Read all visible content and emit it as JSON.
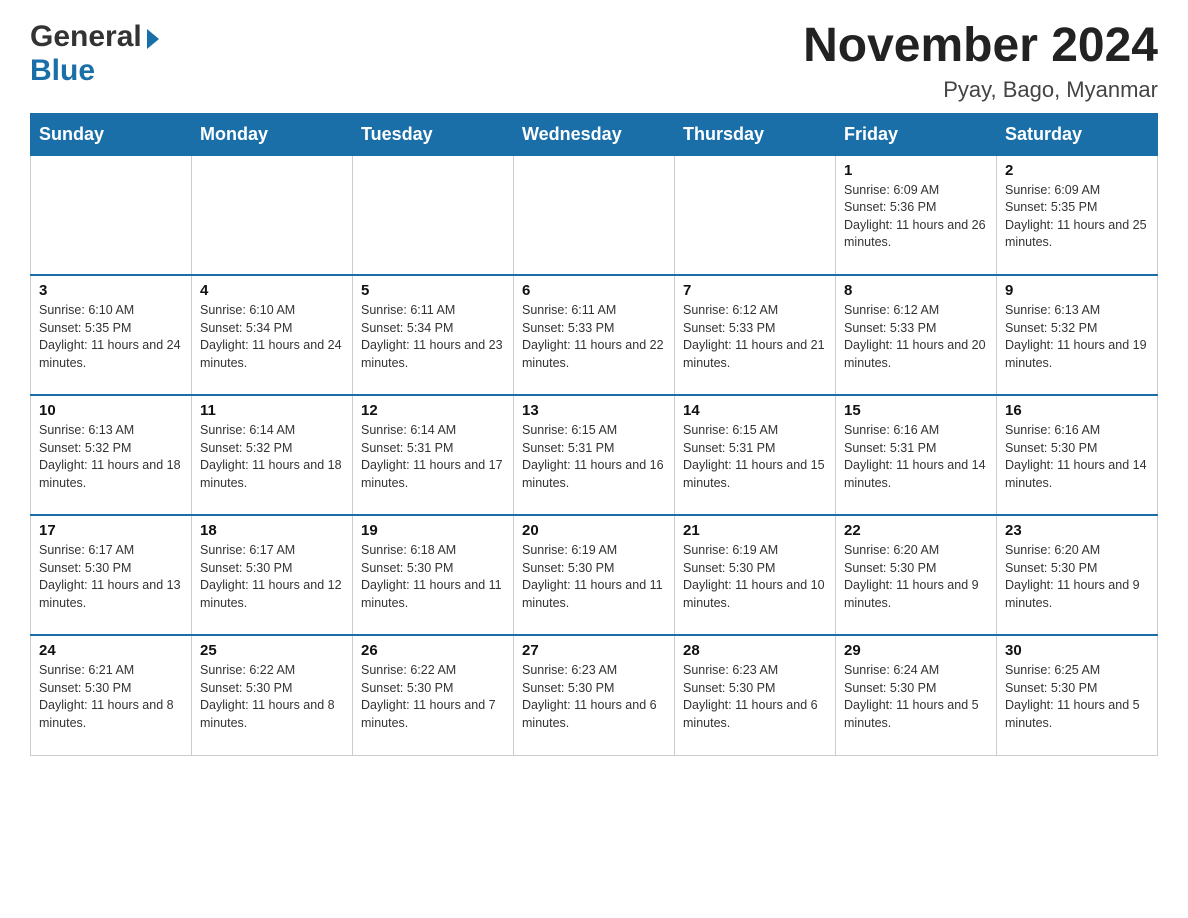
{
  "header": {
    "logo_general": "General",
    "logo_blue": "Blue",
    "title": "November 2024",
    "subtitle": "Pyay, Bago, Myanmar"
  },
  "days_of_week": [
    "Sunday",
    "Monday",
    "Tuesday",
    "Wednesday",
    "Thursday",
    "Friday",
    "Saturday"
  ],
  "weeks": [
    {
      "days": [
        {
          "number": "",
          "info": ""
        },
        {
          "number": "",
          "info": ""
        },
        {
          "number": "",
          "info": ""
        },
        {
          "number": "",
          "info": ""
        },
        {
          "number": "",
          "info": ""
        },
        {
          "number": "1",
          "info": "Sunrise: 6:09 AM\nSunset: 5:36 PM\nDaylight: 11 hours and 26 minutes."
        },
        {
          "number": "2",
          "info": "Sunrise: 6:09 AM\nSunset: 5:35 PM\nDaylight: 11 hours and 25 minutes."
        }
      ]
    },
    {
      "days": [
        {
          "number": "3",
          "info": "Sunrise: 6:10 AM\nSunset: 5:35 PM\nDaylight: 11 hours and 24 minutes."
        },
        {
          "number": "4",
          "info": "Sunrise: 6:10 AM\nSunset: 5:34 PM\nDaylight: 11 hours and 24 minutes."
        },
        {
          "number": "5",
          "info": "Sunrise: 6:11 AM\nSunset: 5:34 PM\nDaylight: 11 hours and 23 minutes."
        },
        {
          "number": "6",
          "info": "Sunrise: 6:11 AM\nSunset: 5:33 PM\nDaylight: 11 hours and 22 minutes."
        },
        {
          "number": "7",
          "info": "Sunrise: 6:12 AM\nSunset: 5:33 PM\nDaylight: 11 hours and 21 minutes."
        },
        {
          "number": "8",
          "info": "Sunrise: 6:12 AM\nSunset: 5:33 PM\nDaylight: 11 hours and 20 minutes."
        },
        {
          "number": "9",
          "info": "Sunrise: 6:13 AM\nSunset: 5:32 PM\nDaylight: 11 hours and 19 minutes."
        }
      ]
    },
    {
      "days": [
        {
          "number": "10",
          "info": "Sunrise: 6:13 AM\nSunset: 5:32 PM\nDaylight: 11 hours and 18 minutes."
        },
        {
          "number": "11",
          "info": "Sunrise: 6:14 AM\nSunset: 5:32 PM\nDaylight: 11 hours and 18 minutes."
        },
        {
          "number": "12",
          "info": "Sunrise: 6:14 AM\nSunset: 5:31 PM\nDaylight: 11 hours and 17 minutes."
        },
        {
          "number": "13",
          "info": "Sunrise: 6:15 AM\nSunset: 5:31 PM\nDaylight: 11 hours and 16 minutes."
        },
        {
          "number": "14",
          "info": "Sunrise: 6:15 AM\nSunset: 5:31 PM\nDaylight: 11 hours and 15 minutes."
        },
        {
          "number": "15",
          "info": "Sunrise: 6:16 AM\nSunset: 5:31 PM\nDaylight: 11 hours and 14 minutes."
        },
        {
          "number": "16",
          "info": "Sunrise: 6:16 AM\nSunset: 5:30 PM\nDaylight: 11 hours and 14 minutes."
        }
      ]
    },
    {
      "days": [
        {
          "number": "17",
          "info": "Sunrise: 6:17 AM\nSunset: 5:30 PM\nDaylight: 11 hours and 13 minutes."
        },
        {
          "number": "18",
          "info": "Sunrise: 6:17 AM\nSunset: 5:30 PM\nDaylight: 11 hours and 12 minutes."
        },
        {
          "number": "19",
          "info": "Sunrise: 6:18 AM\nSunset: 5:30 PM\nDaylight: 11 hours and 11 minutes."
        },
        {
          "number": "20",
          "info": "Sunrise: 6:19 AM\nSunset: 5:30 PM\nDaylight: 11 hours and 11 minutes."
        },
        {
          "number": "21",
          "info": "Sunrise: 6:19 AM\nSunset: 5:30 PM\nDaylight: 11 hours and 10 minutes."
        },
        {
          "number": "22",
          "info": "Sunrise: 6:20 AM\nSunset: 5:30 PM\nDaylight: 11 hours and 9 minutes."
        },
        {
          "number": "23",
          "info": "Sunrise: 6:20 AM\nSunset: 5:30 PM\nDaylight: 11 hours and 9 minutes."
        }
      ]
    },
    {
      "days": [
        {
          "number": "24",
          "info": "Sunrise: 6:21 AM\nSunset: 5:30 PM\nDaylight: 11 hours and 8 minutes."
        },
        {
          "number": "25",
          "info": "Sunrise: 6:22 AM\nSunset: 5:30 PM\nDaylight: 11 hours and 8 minutes."
        },
        {
          "number": "26",
          "info": "Sunrise: 6:22 AM\nSunset: 5:30 PM\nDaylight: 11 hours and 7 minutes."
        },
        {
          "number": "27",
          "info": "Sunrise: 6:23 AM\nSunset: 5:30 PM\nDaylight: 11 hours and 6 minutes."
        },
        {
          "number": "28",
          "info": "Sunrise: 6:23 AM\nSunset: 5:30 PM\nDaylight: 11 hours and 6 minutes."
        },
        {
          "number": "29",
          "info": "Sunrise: 6:24 AM\nSunset: 5:30 PM\nDaylight: 11 hours and 5 minutes."
        },
        {
          "number": "30",
          "info": "Sunrise: 6:25 AM\nSunset: 5:30 PM\nDaylight: 11 hours and 5 minutes."
        }
      ]
    }
  ]
}
